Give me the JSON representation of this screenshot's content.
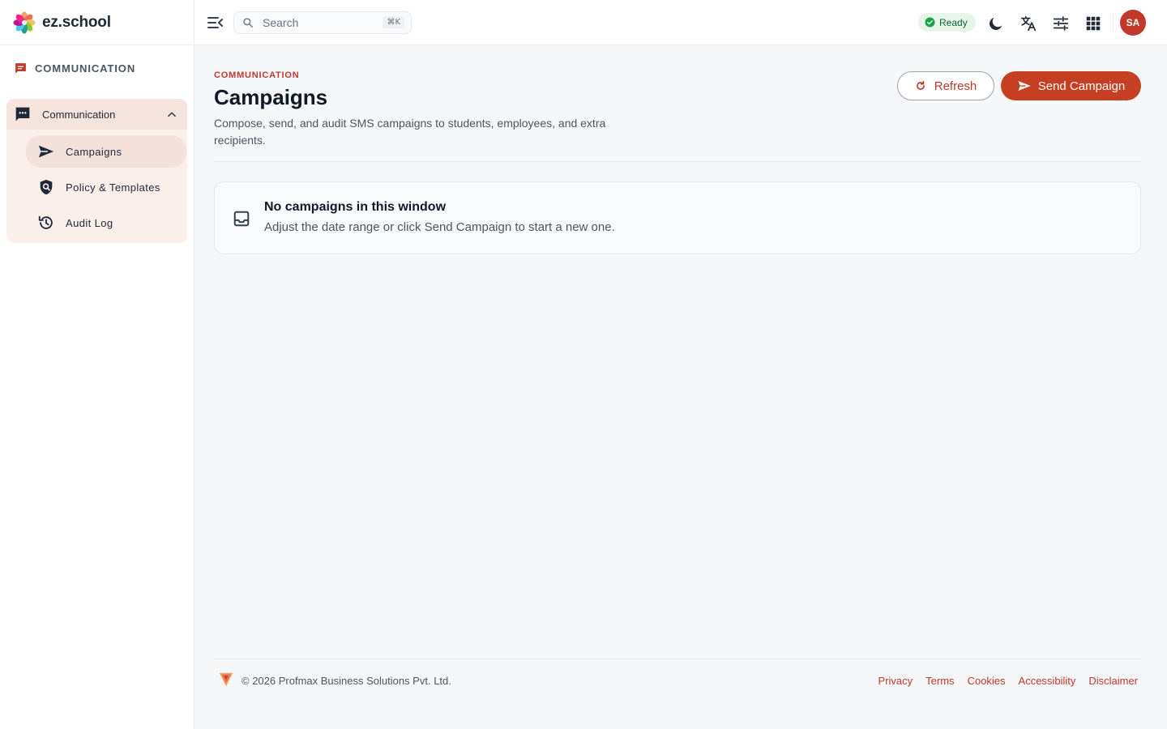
{
  "brand": {
    "name": "ez.school"
  },
  "sidebar": {
    "section_label": "COMMUNICATION",
    "group": {
      "label": "Communication",
      "items": [
        {
          "label": "Campaigns",
          "icon": "send-icon",
          "active": true
        },
        {
          "label": "Policy & Templates",
          "icon": "shield-search-icon",
          "active": false
        },
        {
          "label": "Audit Log",
          "icon": "history-icon",
          "active": false
        }
      ]
    }
  },
  "topbar": {
    "search_placeholder": "Search",
    "search_shortcut": "⌘K",
    "status_label": "Ready",
    "avatar_initials": "SA"
  },
  "page": {
    "eyebrow": "COMMUNICATION",
    "title": "Campaigns",
    "subtitle": "Compose, send, and audit SMS campaigns to students, employees, and extra recipients.",
    "refresh_label": "Refresh",
    "send_label": "Send Campaign"
  },
  "empty_state": {
    "title": "No campaigns in this window",
    "subtitle": "Adjust the date range or click Send Campaign to start a new one."
  },
  "footer": {
    "copyright": "© 2026 Profmax Business Solutions Pvt. Ltd.",
    "links": [
      "Privacy",
      "Terms",
      "Cookies",
      "Accessibility",
      "Disclaimer"
    ]
  },
  "colors": {
    "accent": "#c0392b",
    "primary_button": "#c73f22",
    "status_ok": "#16a34a",
    "active_item_bg": "#f5e1dc"
  }
}
